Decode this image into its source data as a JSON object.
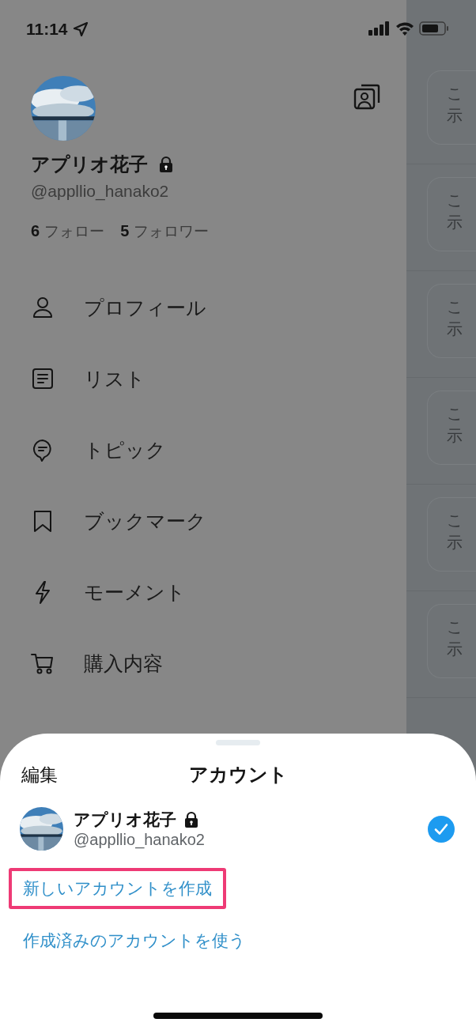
{
  "status_bar": {
    "time": "11:14"
  },
  "profile": {
    "name": "アプリオ花子",
    "protected": true,
    "handle": "@appllio_hanako2",
    "following_count": "6",
    "following_label": "フォロー",
    "followers_count": "5",
    "followers_label": "フォロワー"
  },
  "menu": [
    {
      "label": "プロフィール"
    },
    {
      "label": "リスト"
    },
    {
      "label": "トピック"
    },
    {
      "label": "ブックマーク"
    },
    {
      "label": "モーメント"
    },
    {
      "label": "購入内容"
    }
  ],
  "timeline": [
    {
      "line_1": "こ",
      "line_2": "示"
    },
    {
      "line_1": "こ",
      "line_2": "示"
    },
    {
      "line_1": "こ",
      "line_2": "示"
    },
    {
      "line_1": "こ",
      "line_2": "示"
    },
    {
      "line_1": "こ",
      "line_2": "示"
    },
    {
      "line_1": "こ",
      "line_2": "示"
    }
  ],
  "account_sheet": {
    "edit": "編集",
    "title": "アカウント",
    "accounts": [
      {
        "name": "アプリオ花子",
        "protected": true,
        "handle": "@appllio_hanako2",
        "selected": true
      }
    ],
    "actions": [
      {
        "label": "新しいアカウントを作成",
        "highlighted": true
      },
      {
        "label": "作成済みのアカウントを使う",
        "highlighted": false
      }
    ]
  }
}
